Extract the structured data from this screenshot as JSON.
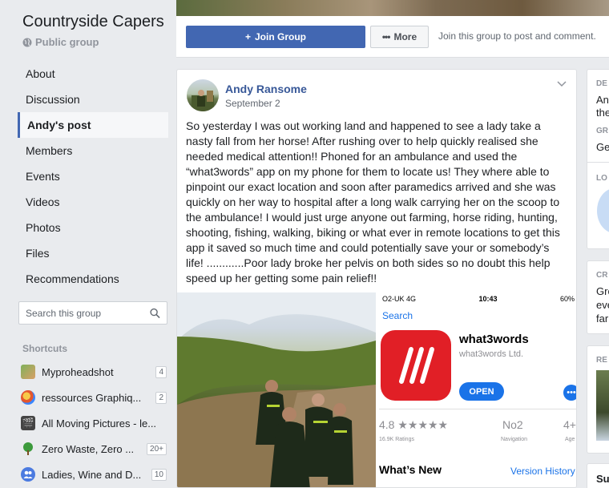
{
  "group": {
    "name": "Countryside Capers",
    "privacy": "Public group"
  },
  "nav": [
    {
      "label": "About"
    },
    {
      "label": "Discussion"
    },
    {
      "label": "Andy's post",
      "active": true
    },
    {
      "label": "Members"
    },
    {
      "label": "Events"
    },
    {
      "label": "Videos"
    },
    {
      "label": "Photos"
    },
    {
      "label": "Files"
    },
    {
      "label": "Recommendations"
    }
  ],
  "search": {
    "placeholder": "Search this group"
  },
  "shortcuts": {
    "title": "Shortcuts",
    "items": [
      {
        "label": "Myproheadshot",
        "count": "4"
      },
      {
        "label": "ressources Graphiq...",
        "count": "2"
      },
      {
        "label": "All Moving Pictures - le...",
        "count": ""
      },
      {
        "label": "Zero Waste, Zero ...",
        "count": "20+"
      },
      {
        "label": "Ladies, Wine and D...",
        "count": "10"
      }
    ]
  },
  "actions": {
    "join_label": "Join Group",
    "more_label": "More",
    "hint": "Join this group to post and comment."
  },
  "post": {
    "author": "Andy Ransome",
    "date": "September 2",
    "text": "So yesterday I was out working land and happened to see a lady take a nasty fall from her horse! After rushing over to help quickly realised she needed medical attention!! Phoned for an ambulance and used the “what3words” app on my phone for them to locate us! They where able to pinpoint our exact location and soon after paramedics arrived and she was quickly on her way to hospital after a long walk carrying her on the scoop to the ambulance! I would just urge anyone out farming, horse riding, hunting, shooting, fishing, walking, biking or what ever in remote locations to get this app it saved so much time and could potentially save your or somebody’s life! ............Poor lady broke her pelvis on both sides so no doubt this help speed up her getting some pain relief!!"
  },
  "screenshot": {
    "carrier": "O2-UK  4G",
    "time": "10:43",
    "battery": "60%",
    "back": "Search",
    "app_name": "what3words",
    "developer": "what3words Ltd.",
    "open": "OPEN",
    "rating": "4.8 ★★★★★",
    "ratings_count": "16.9K Ratings",
    "rank": "No2",
    "rank_label": "Navigation",
    "age": "4+",
    "age_label": "Age",
    "whats_new": "What’s New",
    "version_history": "Version History"
  },
  "right": {
    "desc_head": "DE",
    "desc_1": "An",
    "desc_2": "the",
    "group_head": "GR",
    "group_text": "Ge",
    "loc_head": "LO",
    "created_head": "CR",
    "created_1": "Gro",
    "created_2": "eve",
    "created_3": "far",
    "recent_head": "RE",
    "bottom": "Su"
  },
  "colors": {
    "brand": "#4267b2",
    "link": "#385898",
    "app_red": "#e11f26",
    "ios_blue": "#1a73e8"
  }
}
